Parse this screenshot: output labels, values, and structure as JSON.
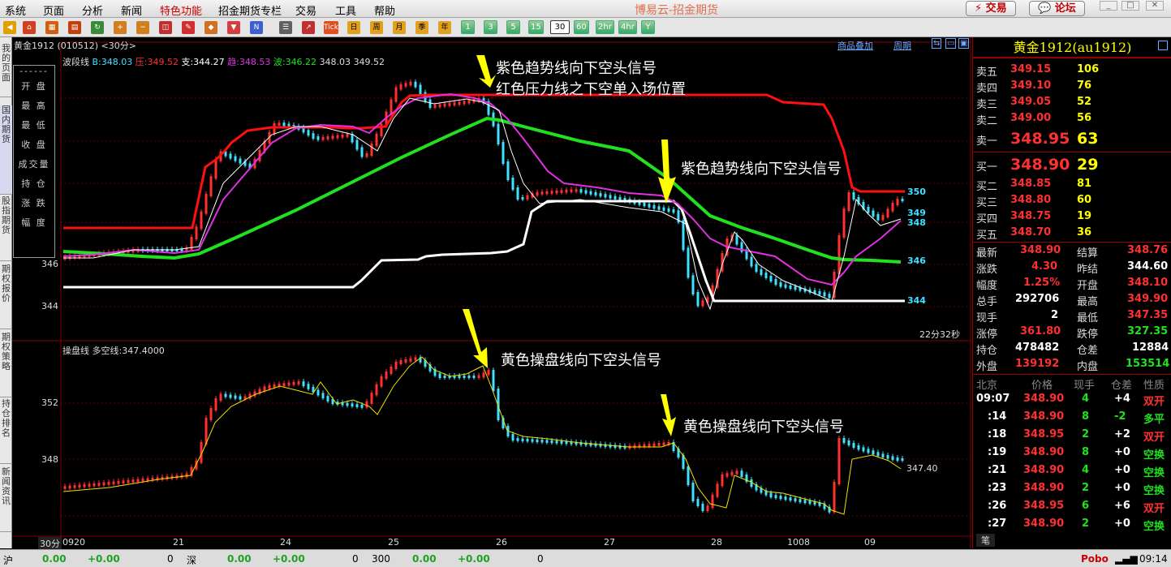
{
  "menu": {
    "items": [
      "系统",
      "页面",
      "分析",
      "新闻",
      "特色功能",
      "招金期货专栏",
      "交易",
      "工具",
      "帮助"
    ],
    "app_title": "博易云-招金期货",
    "trade_button": "⚡ 交易",
    "forum_button": "💬 论坛"
  },
  "toolbar": {
    "tick_label": "Tick",
    "periods": [
      "日",
      "周",
      "月",
      "季",
      "年"
    ],
    "minutes": [
      "1",
      "3",
      "5",
      "15",
      "30",
      "60",
      "2hr",
      "4hr",
      "Y"
    ],
    "selected": "30"
  },
  "sidebar": {
    "tabs": [
      "我的页面",
      "国内期货",
      "股指期货",
      "期权报价",
      "期权策略",
      "持仓排名",
      "新闻资讯"
    ]
  },
  "chart": {
    "header": "黄金1912 (010512) <30分>",
    "indicator_name": "波段线",
    "b_label": "B:348.03",
    "pressure_label": "压:349.52",
    "support_label": "支:344.27",
    "trend_label": "趋:348.53",
    "wave_label": "波:346.22",
    "extra1": "348.03",
    "extra2": "349.52",
    "top_links": [
      "商品叠加",
      "周期"
    ],
    "price_labels": [
      "346",
      "344"
    ],
    "line_end_labels": [
      "350",
      "349",
      "348",
      "346",
      "344"
    ],
    "timer": "22分32秒",
    "infobox": [
      "------",
      "开 盘",
      "最 高",
      "最 低",
      "收 盘",
      "成交量",
      "持 仓",
      "涨 跌",
      "幅 度"
    ],
    "annotation1a": "紫色趋势线向下空头信号",
    "annotation1b": "红色压力线之下空单入场位置",
    "annotation2": "紫色趋势线向下空头信号",
    "sub_indicator": "操盘线  多空线:347.4000",
    "sub_price_labels": [
      "352",
      "348"
    ],
    "sub_end_label": "347.40",
    "annotation3": "黄色操盘线向下空头信号",
    "annotation4": "黄色操盘线向下空头信号",
    "x_period": "30分",
    "x_labels": [
      "0920",
      "21",
      "24",
      "25",
      "26",
      "27",
      "28",
      "1008",
      "09"
    ],
    "colors": {
      "up": "#ff3030",
      "down": "#40e0ff",
      "pressure": "#ff1010",
      "trend": "#e030e0",
      "wave": "#20e020",
      "support": "#ffffff",
      "signal": "#ffff00"
    }
  },
  "quote": {
    "title": "黄金1912(au1912)",
    "asks": [
      {
        "label": "卖五",
        "price": "349.15",
        "vol": "106"
      },
      {
        "label": "卖四",
        "price": "349.10",
        "vol": "76"
      },
      {
        "label": "卖三",
        "price": "349.05",
        "vol": "52"
      },
      {
        "label": "卖二",
        "price": "349.00",
        "vol": "56"
      },
      {
        "label": "卖一",
        "price": "348.95",
        "vol": "63"
      }
    ],
    "bids": [
      {
        "label": "买一",
        "price": "348.90",
        "vol": "29"
      },
      {
        "label": "买二",
        "price": "348.85",
        "vol": "81"
      },
      {
        "label": "买三",
        "price": "348.80",
        "vol": "60"
      },
      {
        "label": "买四",
        "price": "348.75",
        "vol": "19"
      },
      {
        "label": "买五",
        "price": "348.70",
        "vol": "36"
      }
    ],
    "stats": [
      {
        "l1": "最新",
        "v1": "348.90",
        "l2": "结算",
        "v2": "348.76"
      },
      {
        "l1": "涨跌",
        "v1": "4.30",
        "l2": "昨结",
        "v2": "344.60"
      },
      {
        "l1": "幅度",
        "v1": "1.25%",
        "l2": "开盘",
        "v2": "348.10"
      },
      {
        "l1": "总手",
        "v1": "292706",
        "l2": "最高",
        "v2": "349.90"
      },
      {
        "l1": "现手",
        "v1": "2",
        "l2": "最低",
        "v2": "347.35"
      },
      {
        "l1": "涨停",
        "v1": "361.80",
        "l2": "跌停",
        "v2": "327.35"
      },
      {
        "l1": "持仓",
        "v1": "478482",
        "l2": "仓差",
        "v2": "12884"
      },
      {
        "l1": "外盘",
        "v1": "139192",
        "l2": "内盘",
        "v2": "153514"
      }
    ],
    "tick_header": [
      "北京",
      "价格",
      "现手",
      "仓差",
      "性质"
    ],
    "ticks": [
      {
        "t": "09:07",
        "p": "348.90",
        "v": "4",
        "d": "+4",
        "n": "双开"
      },
      {
        "t": ":14",
        "p": "348.90",
        "v": "8",
        "d": "-2",
        "n": "多平"
      },
      {
        "t": ":18",
        "p": "348.95",
        "v": "2",
        "d": "+2",
        "n": "双开"
      },
      {
        "t": ":19",
        "p": "348.90",
        "v": "8",
        "d": "+0",
        "n": "空换"
      },
      {
        "t": ":21",
        "p": "348.90",
        "v": "4",
        "d": "+0",
        "n": "空换"
      },
      {
        "t": ":23",
        "p": "348.90",
        "v": "2",
        "d": "+0",
        "n": "空换"
      },
      {
        "t": ":26",
        "p": "348.95",
        "v": "6",
        "d": "+6",
        "n": "双开"
      },
      {
        "t": ":27",
        "p": "348.90",
        "v": "2",
        "d": "+0",
        "n": "空换"
      }
    ],
    "tab_label": "笔"
  },
  "status": {
    "sh_label": "沪",
    "sh_val": "0.00",
    "sh_chg": "+0.00",
    "sh_vol": "0",
    "sz_label": "深",
    "sz_val": "0.00",
    "sz_chg": "+0.00",
    "sz_vol": "0",
    "idx_label": "300",
    "idx_val": "0.00",
    "idx_chg": "+0.00",
    "idx_vol": "0",
    "brand": "Pobo",
    "time": "09:14"
  }
}
